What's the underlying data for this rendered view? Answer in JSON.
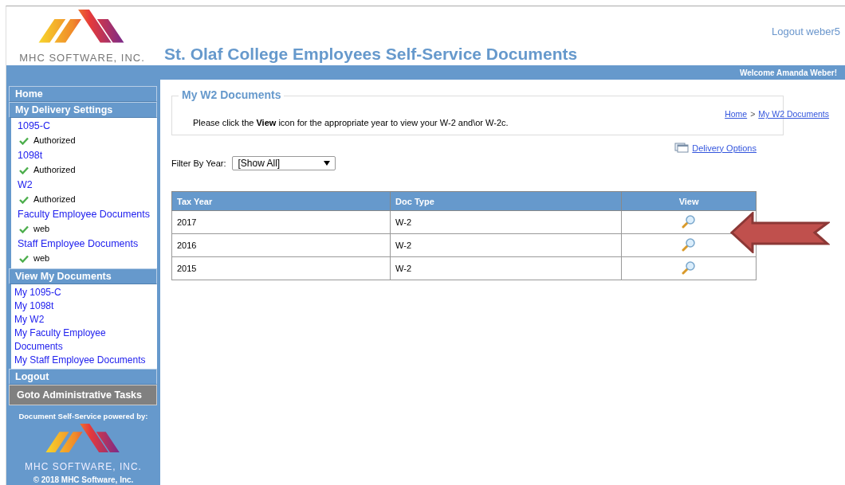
{
  "header": {
    "company": "MHC SOFTWARE, INC.",
    "title": "St. Olaf College Employees Self-Service Documents",
    "logout": "Logout weber5",
    "welcome": "Welcome Amanda Weber!"
  },
  "sidebar": {
    "sections": [
      {
        "kind": "nav",
        "label": "Home"
      },
      {
        "kind": "nav",
        "label": "My Delivery Settings"
      },
      {
        "kind": "settings",
        "items": [
          {
            "label": "1095-C",
            "status": "Authorized"
          },
          {
            "label": "1098t",
            "status": "Authorized"
          },
          {
            "label": "W2",
            "status": "Authorized"
          },
          {
            "label": "Faculty Employee Documents",
            "status": "web"
          },
          {
            "label": "Staff Employee Documents",
            "status": "web"
          }
        ]
      },
      {
        "kind": "nav",
        "label": "View My Documents"
      },
      {
        "kind": "links",
        "items": [
          "My 1095-C",
          "My 1098t",
          "My W2",
          "My Faculty Employee Documents",
          "My Staff Employee Documents"
        ]
      },
      {
        "kind": "nav",
        "label": "Logout"
      },
      {
        "kind": "admin",
        "label": "Goto Administrative Tasks"
      }
    ],
    "powered_by": "Document Self-Service powered by:",
    "company": "MHC SOFTWARE, INC.",
    "copyright": "© 2018  MHC Software, Inc."
  },
  "main": {
    "panel_title": "My W2 Documents",
    "breadcrumb": [
      "Home",
      "My W2 Documents"
    ],
    "breadcrumb_separator": ">",
    "instruction": "Please click the **View** icon for the appropriate year to view your W-2 and\\or W-2c.",
    "delivery_options": "Delivery Options",
    "filter_label": "Filter By Year:",
    "filter_value": "[Show All]",
    "table": {
      "columns": [
        "Tax Year",
        "Doc Type",
        "View"
      ],
      "rows": [
        [
          "2017",
          "W-2"
        ],
        [
          "2016",
          "W-2"
        ],
        [
          "2015",
          "W-2"
        ]
      ]
    }
  }
}
